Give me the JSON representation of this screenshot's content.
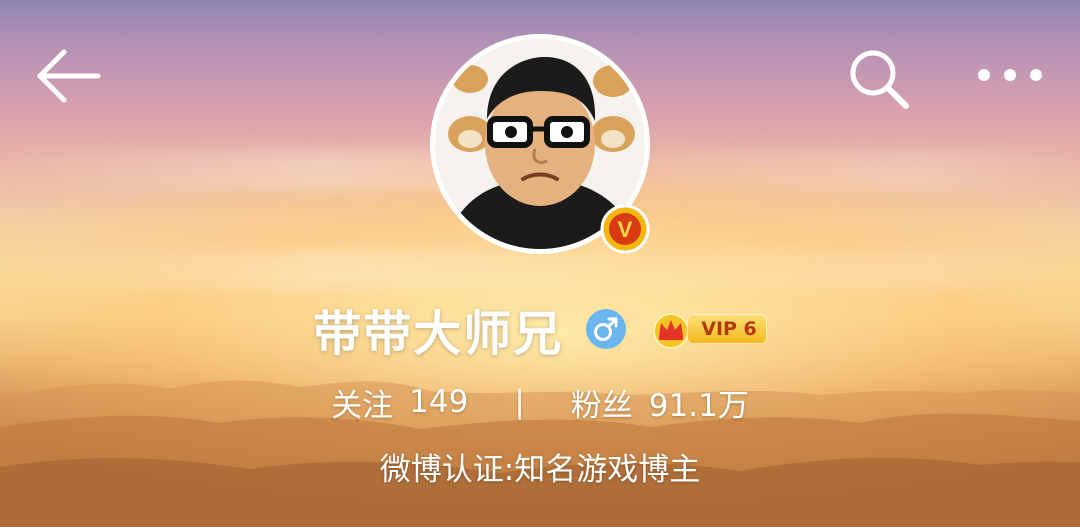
{
  "header": {
    "back_icon": "arrow-left-icon",
    "search_icon": "search-icon",
    "more_icon": "more-horizontal-icon"
  },
  "profile": {
    "avatar_icon": "avatar-cartoon-man-glasses",
    "verified_badge": "V",
    "verified_badge_color": "#e8a40c",
    "username": "带带大师兄",
    "gender_icon": "male-icon",
    "gender_color": "#6bb6ef",
    "vip": {
      "icon": "crown-icon",
      "label": "VIP 6"
    }
  },
  "stats": {
    "following_label": "关注",
    "following_value": "149",
    "separator": "|",
    "followers_label": "粉丝",
    "followers_value": "91.1万"
  },
  "certification": "微博认证:知名游戏博主"
}
